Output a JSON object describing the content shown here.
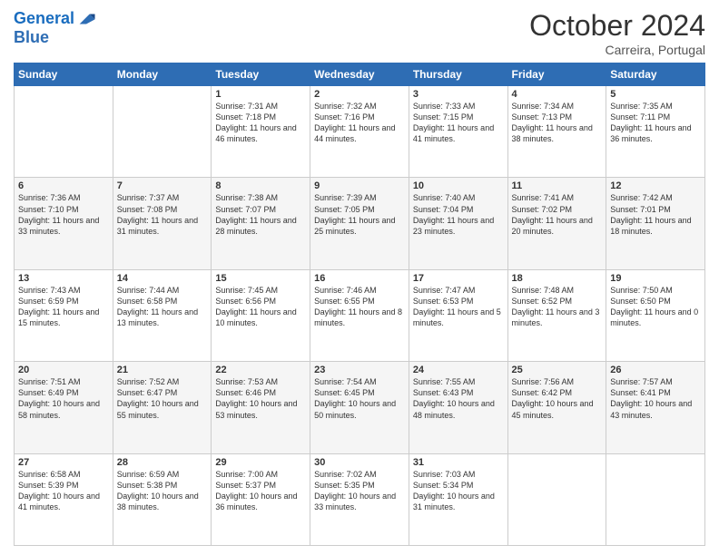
{
  "header": {
    "logo_line1": "General",
    "logo_line2": "Blue",
    "month_title": "October 2024",
    "location": "Carreira, Portugal"
  },
  "days_of_week": [
    "Sunday",
    "Monday",
    "Tuesday",
    "Wednesday",
    "Thursday",
    "Friday",
    "Saturday"
  ],
  "weeks": [
    [
      {
        "day": "",
        "sunrise": "",
        "sunset": "",
        "daylight": ""
      },
      {
        "day": "",
        "sunrise": "",
        "sunset": "",
        "daylight": ""
      },
      {
        "day": "1",
        "sunrise": "Sunrise: 7:31 AM",
        "sunset": "Sunset: 7:18 PM",
        "daylight": "Daylight: 11 hours and 46 minutes."
      },
      {
        "day": "2",
        "sunrise": "Sunrise: 7:32 AM",
        "sunset": "Sunset: 7:16 PM",
        "daylight": "Daylight: 11 hours and 44 minutes."
      },
      {
        "day": "3",
        "sunrise": "Sunrise: 7:33 AM",
        "sunset": "Sunset: 7:15 PM",
        "daylight": "Daylight: 11 hours and 41 minutes."
      },
      {
        "day": "4",
        "sunrise": "Sunrise: 7:34 AM",
        "sunset": "Sunset: 7:13 PM",
        "daylight": "Daylight: 11 hours and 38 minutes."
      },
      {
        "day": "5",
        "sunrise": "Sunrise: 7:35 AM",
        "sunset": "Sunset: 7:11 PM",
        "daylight": "Daylight: 11 hours and 36 minutes."
      }
    ],
    [
      {
        "day": "6",
        "sunrise": "Sunrise: 7:36 AM",
        "sunset": "Sunset: 7:10 PM",
        "daylight": "Daylight: 11 hours and 33 minutes."
      },
      {
        "day": "7",
        "sunrise": "Sunrise: 7:37 AM",
        "sunset": "Sunset: 7:08 PM",
        "daylight": "Daylight: 11 hours and 31 minutes."
      },
      {
        "day": "8",
        "sunrise": "Sunrise: 7:38 AM",
        "sunset": "Sunset: 7:07 PM",
        "daylight": "Daylight: 11 hours and 28 minutes."
      },
      {
        "day": "9",
        "sunrise": "Sunrise: 7:39 AM",
        "sunset": "Sunset: 7:05 PM",
        "daylight": "Daylight: 11 hours and 25 minutes."
      },
      {
        "day": "10",
        "sunrise": "Sunrise: 7:40 AM",
        "sunset": "Sunset: 7:04 PM",
        "daylight": "Daylight: 11 hours and 23 minutes."
      },
      {
        "day": "11",
        "sunrise": "Sunrise: 7:41 AM",
        "sunset": "Sunset: 7:02 PM",
        "daylight": "Daylight: 11 hours and 20 minutes."
      },
      {
        "day": "12",
        "sunrise": "Sunrise: 7:42 AM",
        "sunset": "Sunset: 7:01 PM",
        "daylight": "Daylight: 11 hours and 18 minutes."
      }
    ],
    [
      {
        "day": "13",
        "sunrise": "Sunrise: 7:43 AM",
        "sunset": "Sunset: 6:59 PM",
        "daylight": "Daylight: 11 hours and 15 minutes."
      },
      {
        "day": "14",
        "sunrise": "Sunrise: 7:44 AM",
        "sunset": "Sunset: 6:58 PM",
        "daylight": "Daylight: 11 hours and 13 minutes."
      },
      {
        "day": "15",
        "sunrise": "Sunrise: 7:45 AM",
        "sunset": "Sunset: 6:56 PM",
        "daylight": "Daylight: 11 hours and 10 minutes."
      },
      {
        "day": "16",
        "sunrise": "Sunrise: 7:46 AM",
        "sunset": "Sunset: 6:55 PM",
        "daylight": "Daylight: 11 hours and 8 minutes."
      },
      {
        "day": "17",
        "sunrise": "Sunrise: 7:47 AM",
        "sunset": "Sunset: 6:53 PM",
        "daylight": "Daylight: 11 hours and 5 minutes."
      },
      {
        "day": "18",
        "sunrise": "Sunrise: 7:48 AM",
        "sunset": "Sunset: 6:52 PM",
        "daylight": "Daylight: 11 hours and 3 minutes."
      },
      {
        "day": "19",
        "sunrise": "Sunrise: 7:50 AM",
        "sunset": "Sunset: 6:50 PM",
        "daylight": "Daylight: 11 hours and 0 minutes."
      }
    ],
    [
      {
        "day": "20",
        "sunrise": "Sunrise: 7:51 AM",
        "sunset": "Sunset: 6:49 PM",
        "daylight": "Daylight: 10 hours and 58 minutes."
      },
      {
        "day": "21",
        "sunrise": "Sunrise: 7:52 AM",
        "sunset": "Sunset: 6:47 PM",
        "daylight": "Daylight: 10 hours and 55 minutes."
      },
      {
        "day": "22",
        "sunrise": "Sunrise: 7:53 AM",
        "sunset": "Sunset: 6:46 PM",
        "daylight": "Daylight: 10 hours and 53 minutes."
      },
      {
        "day": "23",
        "sunrise": "Sunrise: 7:54 AM",
        "sunset": "Sunset: 6:45 PM",
        "daylight": "Daylight: 10 hours and 50 minutes."
      },
      {
        "day": "24",
        "sunrise": "Sunrise: 7:55 AM",
        "sunset": "Sunset: 6:43 PM",
        "daylight": "Daylight: 10 hours and 48 minutes."
      },
      {
        "day": "25",
        "sunrise": "Sunrise: 7:56 AM",
        "sunset": "Sunset: 6:42 PM",
        "daylight": "Daylight: 10 hours and 45 minutes."
      },
      {
        "day": "26",
        "sunrise": "Sunrise: 7:57 AM",
        "sunset": "Sunset: 6:41 PM",
        "daylight": "Daylight: 10 hours and 43 minutes."
      }
    ],
    [
      {
        "day": "27",
        "sunrise": "Sunrise: 6:58 AM",
        "sunset": "Sunset: 5:39 PM",
        "daylight": "Daylight: 10 hours and 41 minutes."
      },
      {
        "day": "28",
        "sunrise": "Sunrise: 6:59 AM",
        "sunset": "Sunset: 5:38 PM",
        "daylight": "Daylight: 10 hours and 38 minutes."
      },
      {
        "day": "29",
        "sunrise": "Sunrise: 7:00 AM",
        "sunset": "Sunset: 5:37 PM",
        "daylight": "Daylight: 10 hours and 36 minutes."
      },
      {
        "day": "30",
        "sunrise": "Sunrise: 7:02 AM",
        "sunset": "Sunset: 5:35 PM",
        "daylight": "Daylight: 10 hours and 33 minutes."
      },
      {
        "day": "31",
        "sunrise": "Sunrise: 7:03 AM",
        "sunset": "Sunset: 5:34 PM",
        "daylight": "Daylight: 10 hours and 31 minutes."
      },
      {
        "day": "",
        "sunrise": "",
        "sunset": "",
        "daylight": ""
      },
      {
        "day": "",
        "sunrise": "",
        "sunset": "",
        "daylight": ""
      }
    ]
  ]
}
